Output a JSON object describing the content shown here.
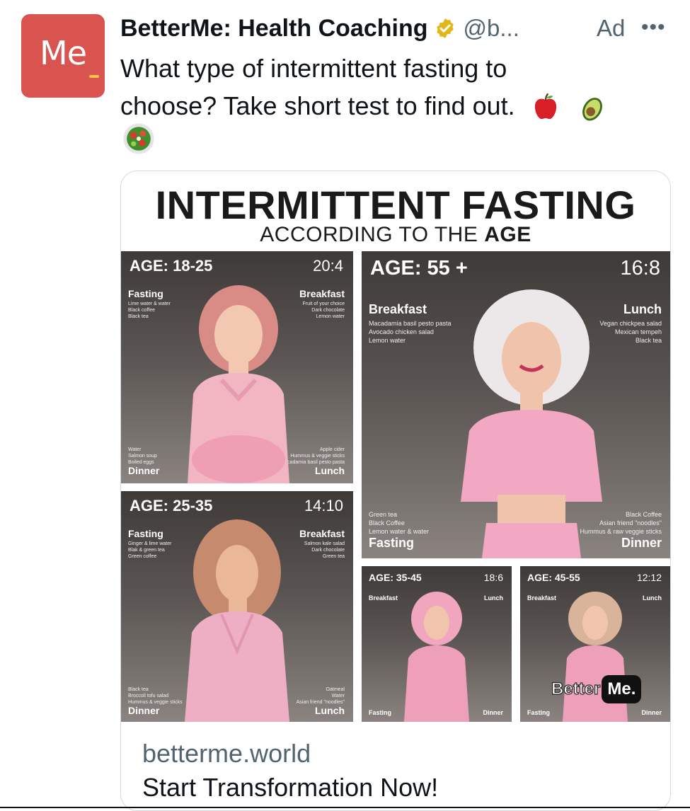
{
  "header": {
    "avatar_text": "Me",
    "name": "BetterMe: Health Coaching",
    "verified_icon": "verified-badge-icon",
    "handle": "@b...",
    "ad_label": "Ad",
    "more_icon": "ellipsis-icon"
  },
  "post": {
    "text_line1": "What type of intermittent fasting to",
    "text_line2": "choose? Take short test to find out.",
    "emojis": [
      "apple-icon",
      "avocado-icon",
      "salad-icon"
    ]
  },
  "media": {
    "title": "INTERMITTENT FASTING",
    "subtitle_prefix": "ACCORDING TO THE ",
    "subtitle_bold": "AGE",
    "panels": [
      {
        "age": "AGE: 18-25",
        "ratio": "20:4",
        "tl_label": "Fasting",
        "tl_items": "Lime water & water\nBlack coffee\nBlack tea",
        "tr_label": "Breakfast",
        "tr_items": "Fruit of your choice\nDark chocolate\nLemon water",
        "bl_label": "Dinner",
        "bl_items": "Water\nSalmon soup\nBoiled eggs",
        "br_label": "Lunch",
        "br_items": "Apple cider\nHummus & veggie sticks\nMacadamia basil pesto pasta"
      },
      {
        "age": "AGE: 55 +",
        "ratio": "16:8",
        "tl_label": "Breakfast",
        "tl_items": "Macadamia basil pesto pasta\nAvocado chicken salad\nLemon water",
        "tr_label": "Lunch",
        "tr_items": "Vegan chickpea salad\nMexican tempeh\nBlack tea",
        "bl_label": "Fasting",
        "bl_items": "Green tea\nBlack Coffee\nLemon water & water",
        "br_label": "Dinner",
        "br_items": "Black Coffee\nAsian friend \"noodles\"\nHummus & raw veggie sticks"
      },
      {
        "age": "AGE: 25-35",
        "ratio": "14:10",
        "tl_label": "Fasting",
        "tl_items": "Ginger & lime water\nBlak & green tea\nGreen coffee",
        "tr_label": "Breakfast",
        "tr_items": "Salmon kale salad\nDark chocolate\nGreen tea",
        "bl_label": "Dinner",
        "bl_items": "Black tea\nBroccoli tofu salad\nHummus & veggie sticks",
        "br_label": "Lunch",
        "br_items": "Oatmeal\nWater\nAsian friend \"noodles\""
      },
      {
        "age": "AGE: 35-45",
        "ratio": "18:6",
        "tl_label": "Breakfast",
        "tr_label": "Lunch",
        "bl_label": "Fasting",
        "br_label": "Dinner"
      },
      {
        "age": "AGE: 45-55",
        "ratio": "12:12",
        "tl_label": "Breakfast",
        "tr_label": "Lunch",
        "bl_label": "Fasting",
        "br_label": "Dinner"
      }
    ],
    "watermark_text": "Better",
    "watermark_box": "Me."
  },
  "card": {
    "domain": "betterme.world",
    "cta": "Start Transformation Now!"
  }
}
